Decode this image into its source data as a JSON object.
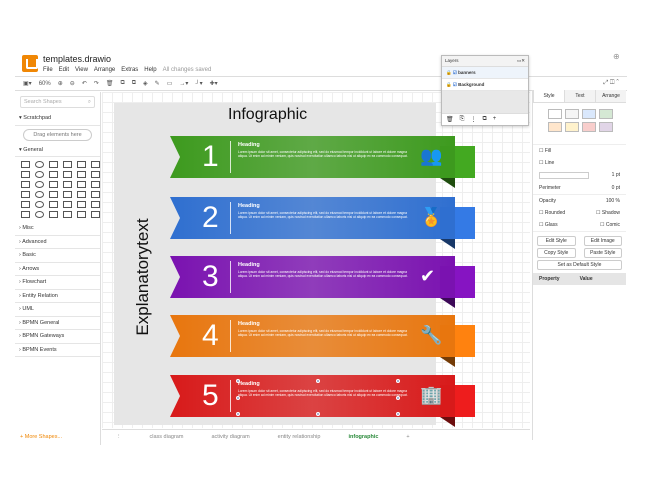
{
  "app": {
    "title": "templates.drawio",
    "menu": [
      "File",
      "Edit",
      "View",
      "Arrange",
      "Extras",
      "Help"
    ],
    "status": "All changes saved"
  },
  "toolbar": {
    "zoom": "60%"
  },
  "sidebar": {
    "search_placeholder": "Search Shapes",
    "scratchpad": "Scratchpad",
    "drag_hint": "Drag elements here",
    "general": "General",
    "sections": [
      "Misc",
      "Advanced",
      "Basic",
      "Arrows",
      "Flowchart",
      "Entity Relation",
      "UML",
      "BPMN General",
      "BPMN Gateways",
      "BPMN Events"
    ],
    "more_shapes": "+ More Shapes..."
  },
  "diagram": {
    "title": "Infographic",
    "side_text": "Explanatorytext",
    "banners": [
      {
        "number": "1",
        "heading": "Heading",
        "icon": "users-icon",
        "color": "#3d9a1e",
        "body": "Lorem ipsum dolor sit amet, consectetur adipiscing elit, sed do eiusmod tempor incididunt ut labore et dolore magna aliqua. Ut enim ad minim veniam, quis nostrud exercitation ullamco laboris nisi ut aliquip ex ea commodo consequat."
      },
      {
        "number": "2",
        "heading": "Heading",
        "icon": "award-icon",
        "color": "#2f6fd0",
        "body": "Lorem ipsum dolor sit amet, consectetur adipiscing elit, sed do eiusmod tempor incididunt ut labore et dolore magna aliqua. Ut enim ad minim veniam, quis nostrud exercitation ullamco laboris nisi ut aliquip ex ea commodo consequat."
      },
      {
        "number": "3",
        "heading": "Heading",
        "icon": "badge-check-icon",
        "color": "#7a12b0",
        "body": "Lorem ipsum dolor sit amet, consectetur adipiscing elit, sed do eiusmod tempor incididunt ut labore et dolore magna aliqua. Ut enim ad minim veniam, quis nostrud exercitation ullamco laboris nisi ut aliquip ex ea commodo consequat."
      },
      {
        "number": "4",
        "heading": "Heading",
        "icon": "tools-icon",
        "color": "#e8760e",
        "body": "Lorem ipsum dolor sit amet, consectetur adipiscing elit, sed do eiusmod tempor incididunt ut labore et dolore magna aliqua. Ut enim ad minim veniam, quis nostrud exercitation ullamco laboris nisi ut aliquip ex ea commodo consequat."
      },
      {
        "number": "5",
        "heading": "Heading",
        "icon": "building-icon",
        "color": "#d81a1a",
        "body": "Lorem ipsum dolor sit amet, consectetur adipiscing elit, sed do eiusmod tempor incididunt ut labore et dolore magna aliqua. Ut enim ad minim veniam, quis nostrud exercitation ullamco laboris nisi ut aliquip ex ea commodo consequat."
      }
    ]
  },
  "tabs": [
    "class diagram",
    "activity diagram",
    "entity relationship",
    "infographic"
  ],
  "active_tab": "infographic",
  "layers": {
    "title": "Layers",
    "items": [
      "banners",
      "Background"
    ]
  },
  "format": {
    "tabs": [
      "Style",
      "Text",
      "Arrange"
    ],
    "fill": "Fill",
    "line": "Line",
    "line_width": "1 pt",
    "perimeter": "Perimeter",
    "perimeter_value": "0 pt",
    "opacity": "Opacity",
    "opacity_value": "100 %",
    "rounded": "Rounded",
    "shadow": "Shadow",
    "glass": "Glass",
    "comic": "Comic",
    "edit_style": "Edit Style",
    "edit_image": "Edit Image",
    "copy_style": "Copy Style",
    "paste_style": "Paste Style",
    "set_default": "Set as Default Style",
    "property": "Property",
    "value": "Value",
    "swatches": [
      "#ffffff",
      "#f5f5f5",
      "#dae8fc",
      "#d5e8d4",
      "#ffe6cc",
      "#fff2cc",
      "#f8cecc",
      "#e1d5e7"
    ]
  }
}
